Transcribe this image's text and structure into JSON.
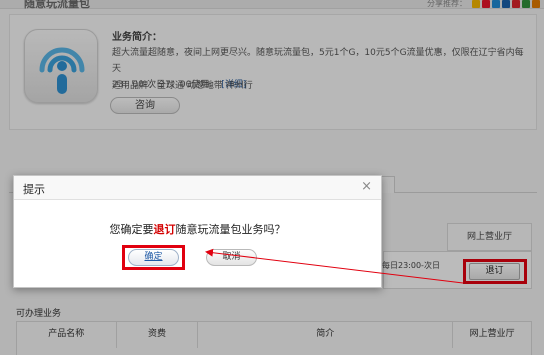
{
  "page": {
    "title": "随意玩流量包",
    "share_label": "分享推荐：",
    "share_icons": [
      {
        "name": "qzone-icon",
        "color": "#f2b400"
      },
      {
        "name": "weibo-icon",
        "color": "#e6162d"
      },
      {
        "name": "tencent-weibo-icon",
        "color": "#1f8ad2"
      },
      {
        "name": "renren-icon",
        "color": "#1a5fa8"
      },
      {
        "name": "kaixin-icon",
        "color": "#d8232a"
      },
      {
        "name": "douban-icon",
        "color": "#2f8f3a"
      },
      {
        "name": "more-share-icon",
        "color": "#e07a00"
      }
    ]
  },
  "intro": {
    "heading": "业务简介：",
    "line1": "超大流量超随意，夜间上网更尽兴。随意玩流量包，5元1个G，10元5个G流量优惠，仅限在辽宁省内每天",
    "line2_prefix": "23：00-次日7：00使用。",
    "detail_link": "[详细]",
    "brands": "适用品牌：全球通  动感地带  神州行",
    "consult_button": "咨询"
  },
  "subscribed": {
    "column_header": "网上营业厅",
    "row_text": "每日23:00-次日",
    "unsubscribe_button": "退订"
  },
  "available": {
    "label": "可办理业务",
    "columns": [
      "产品名称",
      "资费",
      "简介",
      "网上营业厅"
    ]
  },
  "dialog": {
    "title": "提示",
    "close": "×",
    "message_before": "您确定要",
    "message_accent": "退订",
    "message_after": "随意玩流量包业务吗？",
    "ok_button": "确定",
    "cancel_button": "取消"
  },
  "colors": {
    "highlight_red": "#e1000f",
    "link_blue": "#1f5aa6",
    "icon_blue": "#3a9fd8"
  }
}
